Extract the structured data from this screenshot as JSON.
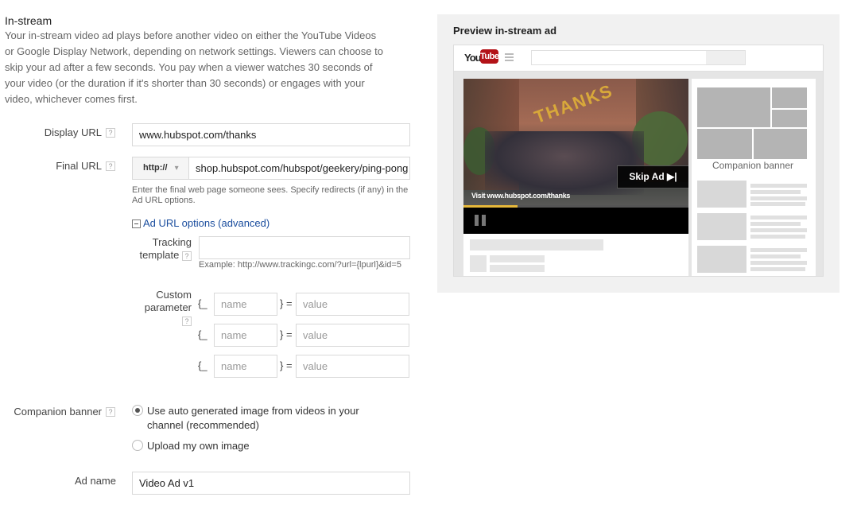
{
  "section": {
    "heading": "In-stream",
    "description": "Your in-stream video ad plays before another video on either the YouTube Videos or Google Display Network, depending on network settings. Viewers can choose to skip your ad after a few seconds. You pay when a viewer watches 30 seconds of your video (or the duration if it's shorter than 30 seconds) or engages with your video, whichever comes first."
  },
  "form": {
    "help_glyph": "?",
    "display_url": {
      "label": "Display URL",
      "value": "www.hubspot.com/thanks"
    },
    "final_url": {
      "label": "Final URL",
      "protocol": "http://",
      "dropdown_glyph": "▾",
      "value": "shop.hubspot.com/hubspot/geekery/ping-pong",
      "hint": "Enter the final web page someone sees. Specify redirects (if any) in the Ad URL options."
    },
    "ad_url_options": {
      "label": "Ad URL options (advanced)",
      "expanded": true
    },
    "tracking_template": {
      "label_line1": "Tracking",
      "label_line2": "template",
      "value": "",
      "example": "Example: http://www.trackingc.com/?url={lpurl}&id=5"
    },
    "custom_parameter": {
      "label_line1": "Custom",
      "label_line2": "parameter",
      "open_brace": "{_",
      "close_eq": "} =",
      "rows": [
        {
          "name_placeholder": "name",
          "value_placeholder": "value"
        },
        {
          "name_placeholder": "name",
          "value_placeholder": "value"
        },
        {
          "name_placeholder": "name",
          "value_placeholder": "value"
        }
      ]
    },
    "companion_banner": {
      "label": "Companion banner",
      "options": [
        {
          "line1": "Use auto generated image from videos in your",
          "line2": "channel (recommended)",
          "selected": true
        },
        {
          "line1": "Upload my own image",
          "line2": "",
          "selected": false
        }
      ]
    },
    "ad_name": {
      "label": "Ad name",
      "value": "Video Ad v1"
    }
  },
  "preview": {
    "title": "Preview in-stream ad",
    "youtube_logo_you": "You",
    "youtube_logo_tube": "Tube",
    "video_overlay_text": "Visit www.hubspot.com/thanks",
    "balloon_text": "THANKS",
    "skip_button": "Skip Ad ▶|",
    "progress": 0.24,
    "companion_banner_label": "Companion banner",
    "colors": {
      "youtube_red": "#b31217",
      "progress_yellow": "#e7b93a"
    }
  }
}
